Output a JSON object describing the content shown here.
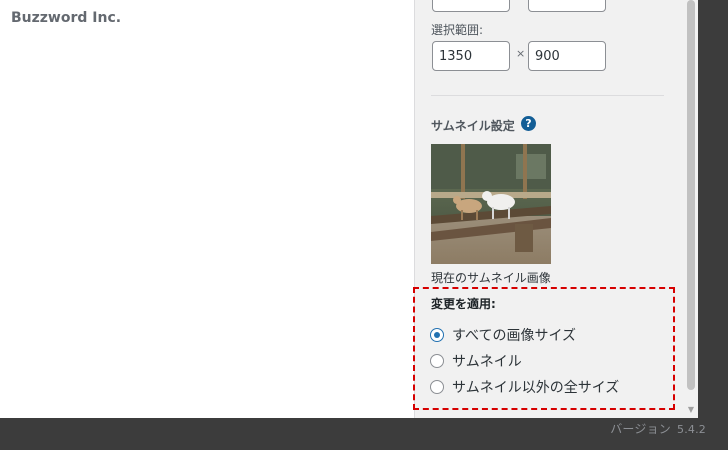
{
  "brand": {
    "text": "Buzzword Inc."
  },
  "crop": {
    "top_fields": {
      "left_value": "",
      "right_value": ""
    },
    "selection_label": "選択範囲:",
    "width_value": "1350",
    "times_symbol": "×",
    "height_value": "900"
  },
  "thumbnail": {
    "section_title": "サムネイル設定",
    "help_symbol": "?",
    "caption": "現在のサムネイル画像"
  },
  "apply": {
    "label": "変更を適用:",
    "options": [
      {
        "label": "すべての画像サイズ",
        "checked": true
      },
      {
        "label": "サムネイル",
        "checked": false
      },
      {
        "label": "サムネイル以外の全サイズ",
        "checked": false
      }
    ]
  },
  "footer": {
    "version_label": "バージョン",
    "version_number": "5.4.2"
  },
  "colors": {
    "accent": "#2271b1",
    "highlight_border": "#d60000",
    "backdrop": "#3c3c3c"
  }
}
